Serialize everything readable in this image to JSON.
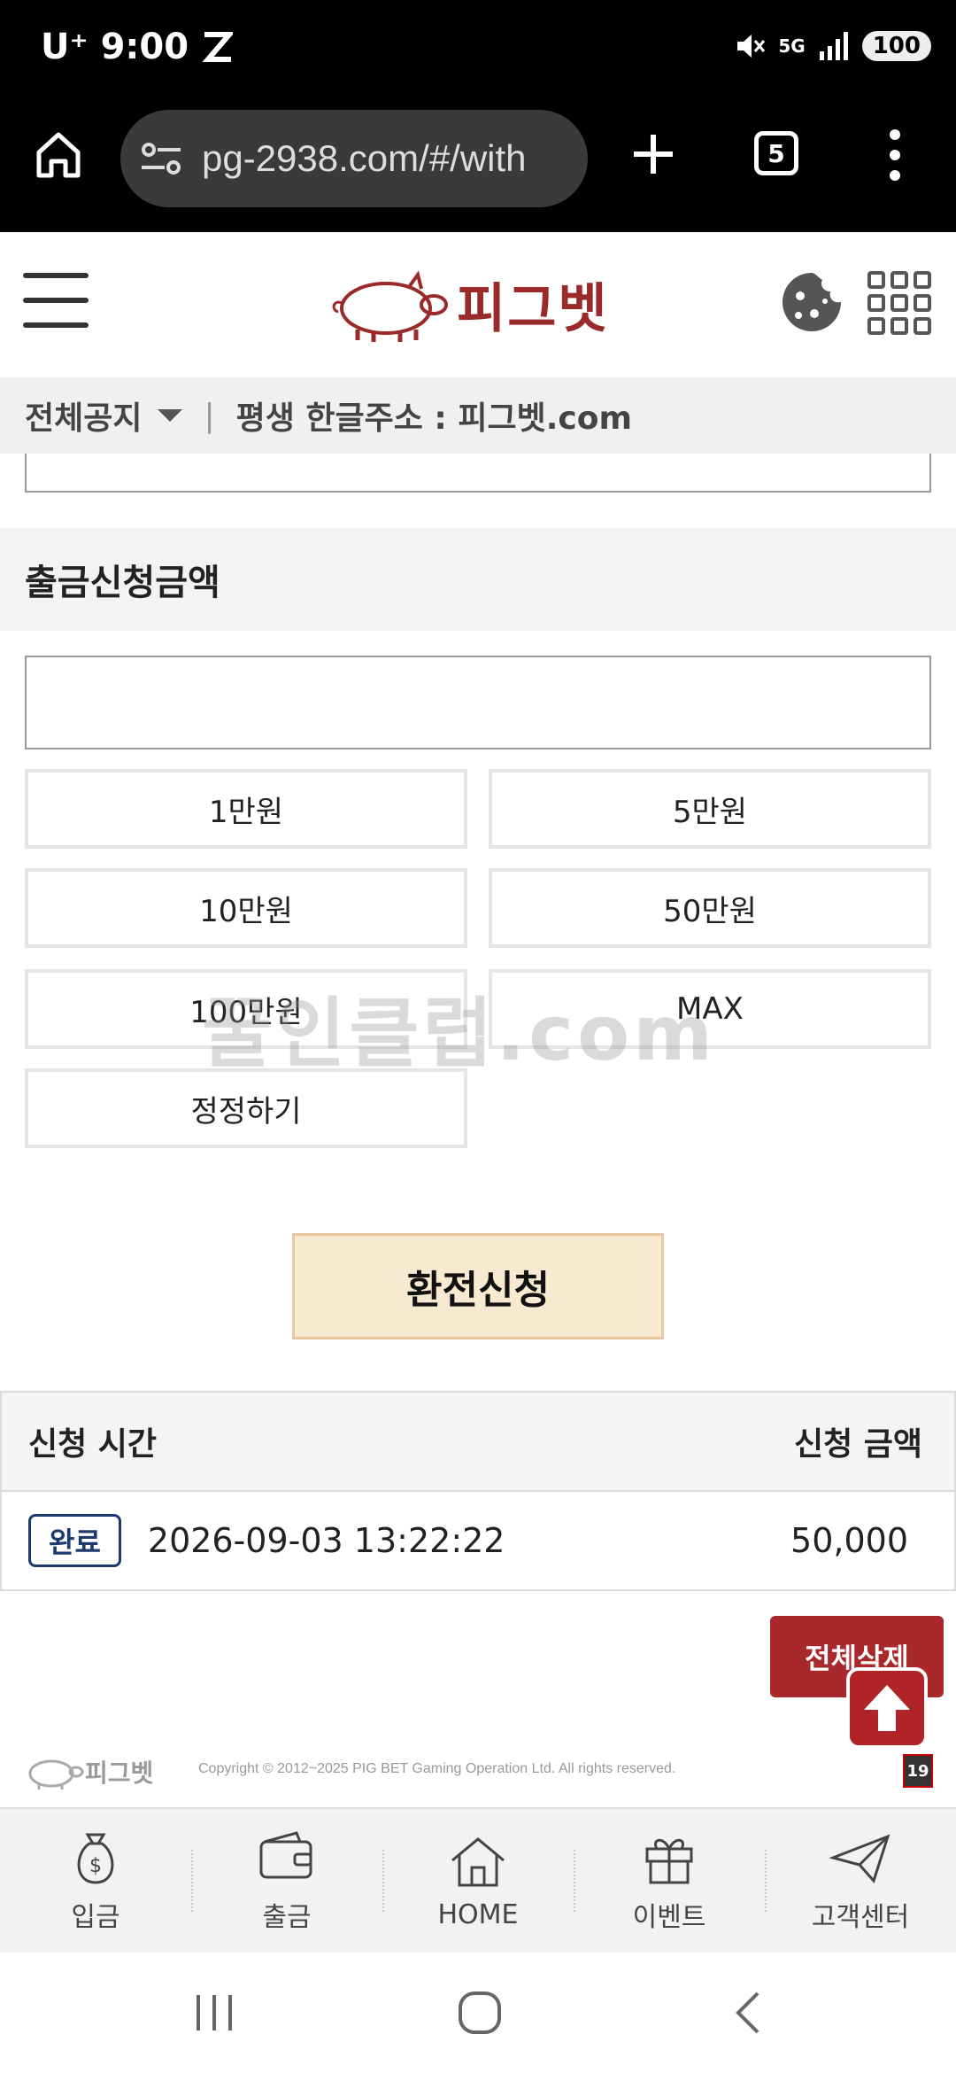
{
  "status_bar": {
    "carrier": "U⁺",
    "time": "9:00",
    "network": "5G",
    "battery": "100"
  },
  "browser": {
    "url": "pg-2938.com/#/with",
    "tab_count": "5"
  },
  "site": {
    "logo_text": "피그벳"
  },
  "notice": {
    "category": "전체공지",
    "text": "평생 한글주소 : 피그벳.com"
  },
  "form": {
    "amount_label": "출금신청금액",
    "amount_value": "",
    "quick_buttons": [
      "1만원",
      "5만원",
      "10만원",
      "50만원",
      "100만원",
      "MAX",
      "정정하기"
    ],
    "submit_label": "환전신청",
    "watermark": "꿀인클럽.com"
  },
  "history": {
    "col_time": "신청 시간",
    "col_amount": "신청 금액",
    "rows": [
      {
        "status": "완료",
        "datetime": "2026-09-03 13:22:22",
        "amount": "50,000"
      }
    ],
    "delete_all_label": "전체삭제"
  },
  "footer": {
    "logo_text": "피그벳",
    "copyright": "Copyright © 2012~2025 PIG BET Gaming Operation Ltd. All rights reserved.",
    "age_badge": "19"
  },
  "bottom_nav": {
    "items": [
      {
        "label": "입금",
        "icon": "money-bag-icon"
      },
      {
        "label": "출금",
        "icon": "wallet-icon"
      },
      {
        "label": "HOME",
        "icon": "house-icon"
      },
      {
        "label": "이벤트",
        "icon": "gift-icon"
      },
      {
        "label": "고객센터",
        "icon": "paper-plane-icon"
      }
    ]
  },
  "colors": {
    "brand": "#9a2a2a",
    "submit_bg": "#f8ead0",
    "delete_bg": "#a8282b",
    "badge": "#1c3a6e"
  }
}
